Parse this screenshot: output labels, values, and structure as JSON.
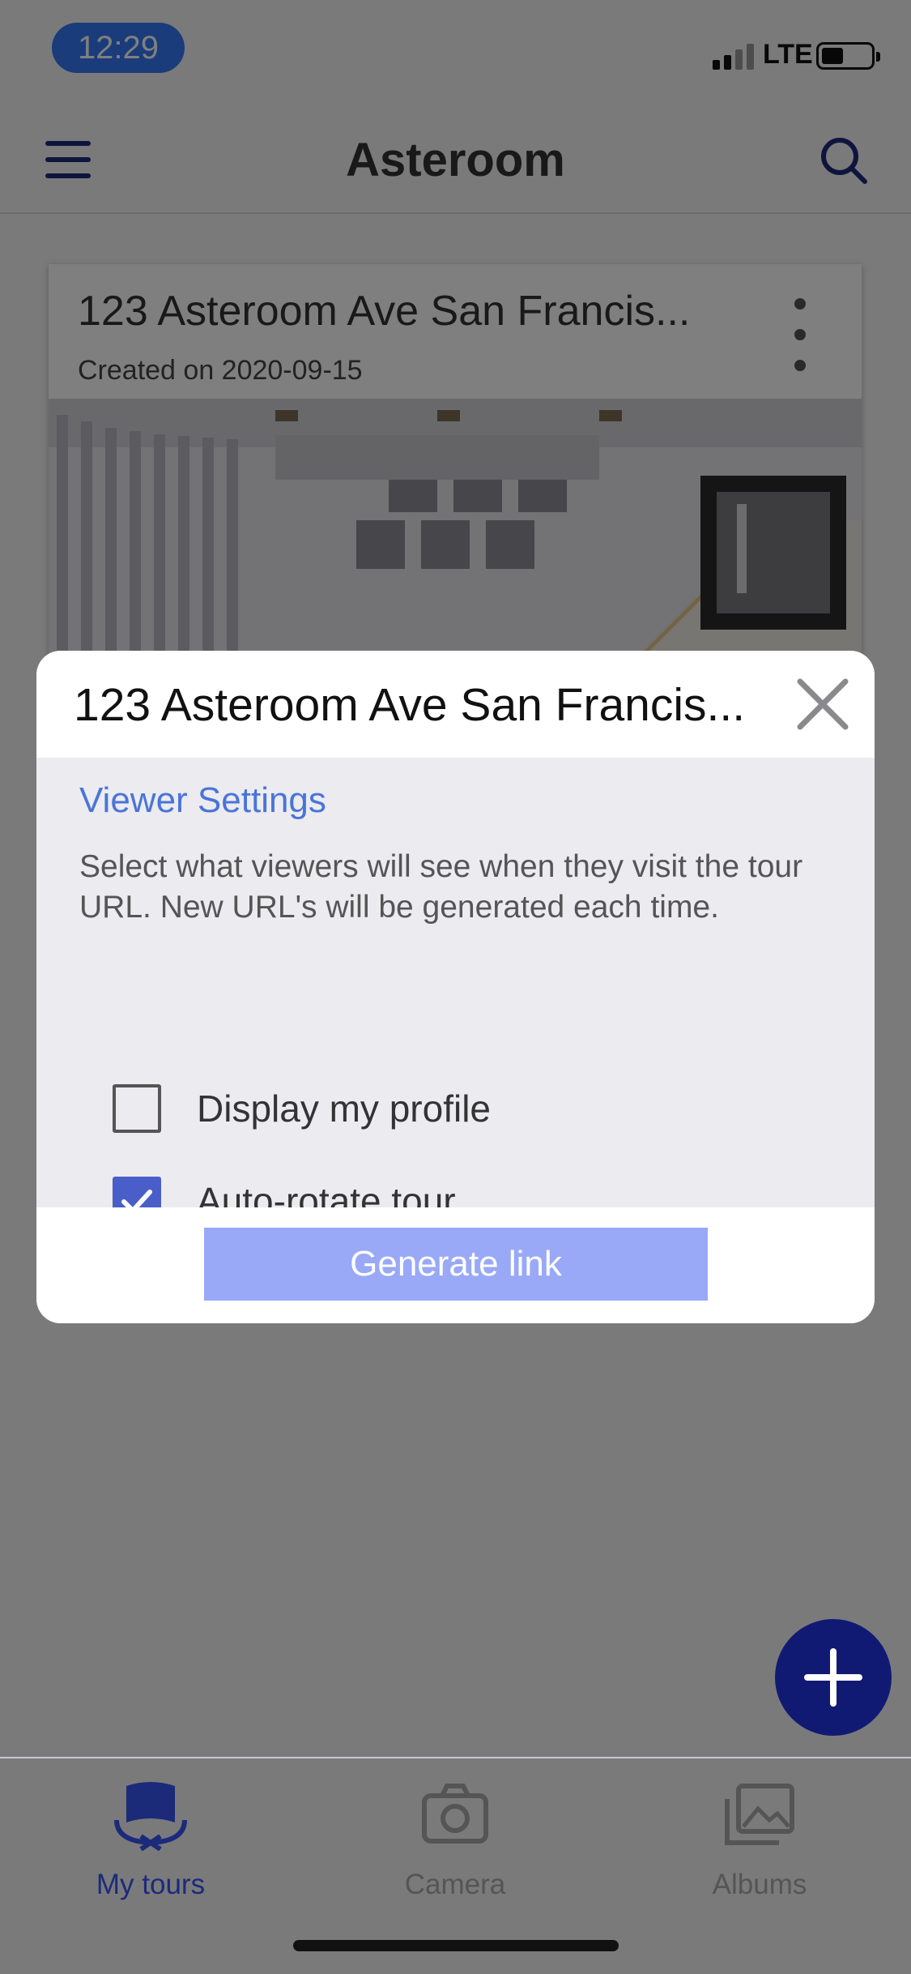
{
  "status_bar": {
    "time": "12:29",
    "network": "LTE",
    "icons": [
      "signal-icon",
      "battery-icon"
    ]
  },
  "nav": {
    "title": "Asteroom",
    "icons": [
      "menu-icon",
      "search-icon"
    ]
  },
  "tour_card": {
    "title": "123 Asteroom Ave San Francis...",
    "created": "Created on 2020-09-15",
    "icons": [
      "more-vertical-icon"
    ]
  },
  "modal": {
    "title": "123 Asteroom Ave San Francis...",
    "section_title": "Viewer Settings",
    "description": "Select what viewers will see when they visit the tour URL. New URL's will be generated each time.",
    "options": [
      {
        "label": "Display my profile",
        "checked": false
      },
      {
        "label": "Auto-rotate tour",
        "checked": true
      }
    ],
    "button_label": "Generate link",
    "icons": [
      "close-icon",
      "checkmark-icon"
    ]
  },
  "fab": {
    "icon": "plus-icon"
  },
  "tabs": [
    {
      "label": "My tours",
      "icon": "my-tours-icon",
      "active": true
    },
    {
      "label": "Camera",
      "icon": "camera-icon",
      "active": false
    },
    {
      "label": "Albums",
      "icon": "albums-icon",
      "active": false
    }
  ],
  "colors": {
    "accent": "#3478f6",
    "primary": "#111a73",
    "link": "#4a74d8",
    "checkbox_checked": "#4a5ec9",
    "button_disabled": "#99a9f7"
  }
}
